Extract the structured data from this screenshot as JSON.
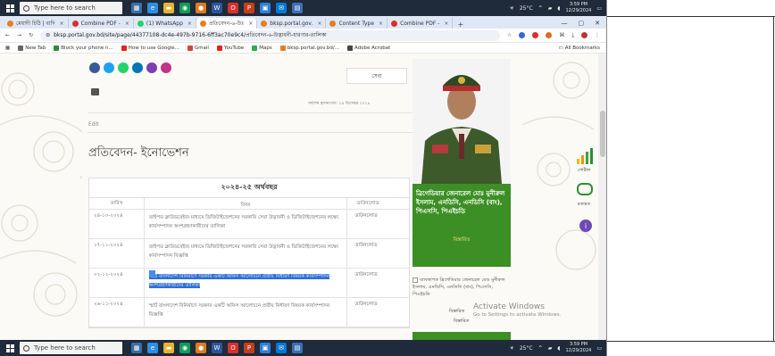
{
  "taskbar": {
    "search_placeholder": "Type here to search",
    "weather": "25°C",
    "time": "3:59 PM",
    "date": "12/29/2024"
  },
  "tabs": [
    {
      "label": "মেয়াদী চিঠি | বাদি",
      "color": "#e67e22"
    },
    {
      "label": "Combine PDF -",
      "color": "#d9302c"
    },
    {
      "label": "(1) WhatsApp",
      "color": "#25d366"
    },
    {
      "label": "প্রতিবেদন-৬-উঃ",
      "color": "#e67e22",
      "active": true
    },
    {
      "label": "bksp.portal.gov.",
      "color": "#e67e22"
    },
    {
      "label": "Content Type",
      "color": "#e67e22"
    },
    {
      "label": "Combine PDF -",
      "color": "#d9302c"
    }
  ],
  "address": {
    "url": "bksp.portal.gov.bd/site/page/44377108-dc4e-497b-9716-6ff3ac70e9c4/প্রতিবেদন-৬-উদ্ভাবনী-ধারণার-তালিকা"
  },
  "bookmarks": {
    "items": [
      "New Tab",
      "Block your phone n...",
      "How to use Google...",
      "Gmail",
      "YouTube",
      "Maps",
      "bksp.portal.gov.bd/...",
      "Adobe Acrobat"
    ],
    "all": "All Bookmarks"
  },
  "page": {
    "seba_label": "সেবা",
    "updated": "সর্বশেষ হালনাগাদ: ২৯ ডিসেম্বর ২০২৪",
    "edit": "Edit",
    "title": "প্রতিবেদন- ইনোভেশন"
  },
  "table": {
    "caption": "২০২৪-২৫ অর্থবছর",
    "headers": {
      "date": "তারিখ",
      "subject": "বিষয়",
      "download": "ডাউনলোড"
    },
    "rows": [
      {
        "date": "২৪-১০-২০২৪",
        "subject": "তাইপড ক্লাউডবেইজ মাধ্যমে ডিজিটাইজেশনের সরকারি সেবা উদ্ভাবনী ও ডিজিটাইজেশনের লক্ষ্যে কার্যসম্পাদন অংশগ্রহণকারীদের তালিকা",
        "download": "ডাউনলোড"
      },
      {
        "date": "১৭-১১-২০২৪",
        "subject": "তাইপড ক্লাউডবেইজ মাধ্যমে ডিজিটাইজেশনের সরকারি সেবা উদ্ভাবনী ও ডিজিটাইজেশনের লক্ষ্যে কার্যসম্পাদন বিজ্ঞপ্তি",
        "download": "ডাউনলোড"
      },
      {
        "date": "০২-১২-২০২৪",
        "subject": "স্মার্ট বাংলাদেশ বিনির্মাণে সরকার একটি অফিস আলোচনে প্রতীয় নির্ধারণ বিষয়ক কার্যসম্পাদন অংশগ্রহণকারীদের তালিকা",
        "download": "ডাউনলোড",
        "selected": true
      },
      {
        "date": "২৬-১১-২০২৪",
        "subject": "স্মার্ট বাংলাদেশ বিনির্মাণে সরকার একটি অফিস আলোচনে প্রতীয় নির্ধারণ বিষয়ক কার্যসম্পাদন বিজ্ঞপ্তি",
        "download": "ডাউনলোড"
      }
    ]
  },
  "sidebar": {
    "officer_name": "ব্রিগেডিয়ার জেনারেল মোঃ মুনীরুল ইসলাম, এনডিসি, এনডিসি (বাং), পিএসসি, পিএইচডি",
    "more": "বিস্তারিত",
    "list_item": "ব্যাবস্থাপক ব্রিগেডিয়ার জেনারেল মোঃ মুনীরুল ইসলাম, এনডিসি, এনডিসি (বাং), পিএসসি, পিএইচডি",
    "more1": "বিস্তারিত",
    "more2": "বিস্তারিত"
  },
  "widgets": {
    "stats_label": "পোর্টাল",
    "chat_label": "মতামত"
  },
  "watermark": {
    "title": "Activate Windows",
    "subtitle": "Go to Settings to activate Windows."
  }
}
